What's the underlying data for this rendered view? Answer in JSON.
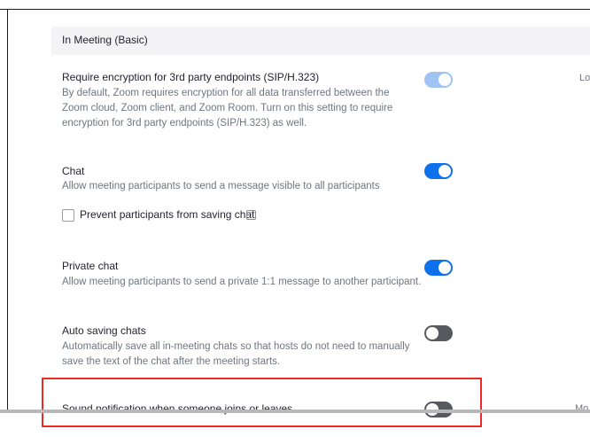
{
  "section": {
    "title": "In Meeting (Basic)"
  },
  "settings": [
    {
      "title": "Require encryption for 3rd party endpoints (SIP/H.323)",
      "description": "By default, Zoom requires encryption for all data transferred between the Zoom cloud, Zoom client, and Zoom Room. Turn on this setting to require encryption for 3rd party endpoints (SIP/H.323) as well.",
      "toggle_state": "on-locked",
      "right_label": "Lo"
    },
    {
      "title": "Chat",
      "description": "Allow meeting participants to send a message visible to all participants",
      "toggle_state": "on",
      "sub_option": {
        "label": "Prevent participants from saving chat",
        "checked": false,
        "info_icon": "info-icon"
      }
    },
    {
      "title": "Private chat",
      "description": "Allow meeting participants to send a private 1:1 message to another participant.",
      "toggle_state": "on"
    },
    {
      "title": "Auto saving chats",
      "description": "Automatically save all in-meeting chats so that hosts do not need to manually save the text of the chat after the meeting starts.",
      "toggle_state": "off"
    },
    {
      "title": "Sound notification when someone joins or leaves",
      "toggle_state": "off",
      "right_label": "Mo"
    }
  ],
  "colors": {
    "toggle_on": "#0e71eb",
    "toggle_on_locked": "#9fc4f3",
    "toggle_off": "#58585f",
    "highlight": "#ee2a24"
  }
}
